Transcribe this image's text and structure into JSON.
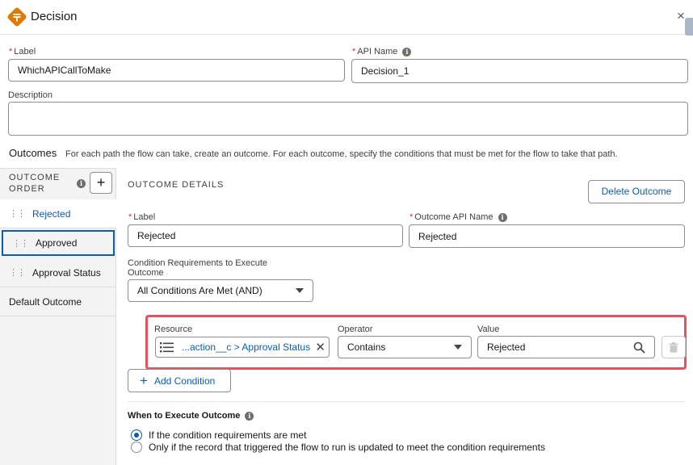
{
  "header": {
    "title": "Decision",
    "close_label": "×"
  },
  "fields": {
    "label": {
      "label": "Label",
      "value": "WhichAPICallToMake"
    },
    "api_name": {
      "label": "API Name",
      "value": "Decision_1"
    },
    "description": {
      "label": "Description",
      "value": ""
    }
  },
  "outcomes": {
    "title": "Outcomes",
    "description": "For each path the flow can take, create an outcome. For each outcome, specify the conditions that must be met for the flow to take that path."
  },
  "sidebar": {
    "order_title_1": "OUTCOME",
    "order_title_2": "ORDER",
    "add_label": "+",
    "items": [
      {
        "label": "Rejected"
      },
      {
        "label": "Approved"
      },
      {
        "label": "Approval Status"
      },
      {
        "label": "Default Outcome"
      }
    ]
  },
  "details": {
    "title": "OUTCOME DETAILS",
    "delete_label": "Delete Outcome",
    "label": {
      "label": "Label",
      "value": "Rejected"
    },
    "api_name": {
      "label": "Outcome API Name",
      "value": "Rejected"
    },
    "condition_req": {
      "label_line1": "Condition Requirements to Execute",
      "label_line2": "Outcome",
      "value": "All Conditions Are Met (AND)"
    },
    "condition": {
      "resource_label": "Resource",
      "resource_value": "...action__c > Approval Status",
      "operator_label": "Operator",
      "operator_value": "Contains",
      "value_label": "Value",
      "value_value": "Rejected"
    },
    "add_condition_label": "Add Condition",
    "when": {
      "title": "When to Execute Outcome",
      "options": [
        {
          "label": "If the condition requirements are met",
          "selected": true
        },
        {
          "label": "Only if the record that triggered the flow to run is updated to meet the condition requirements",
          "selected": false
        }
      ]
    }
  },
  "colors": {
    "brand_orange": "#dd7a01",
    "link_blue": "#0b5cab",
    "highlight_red": "#e8505b"
  },
  "icons": [
    "decision-icon",
    "close-icon",
    "info-icon",
    "add-icon",
    "drag-handle-icon",
    "chevron-down-icon",
    "list-icon",
    "clear-icon",
    "search-icon",
    "trash-icon",
    "plus-icon"
  ]
}
